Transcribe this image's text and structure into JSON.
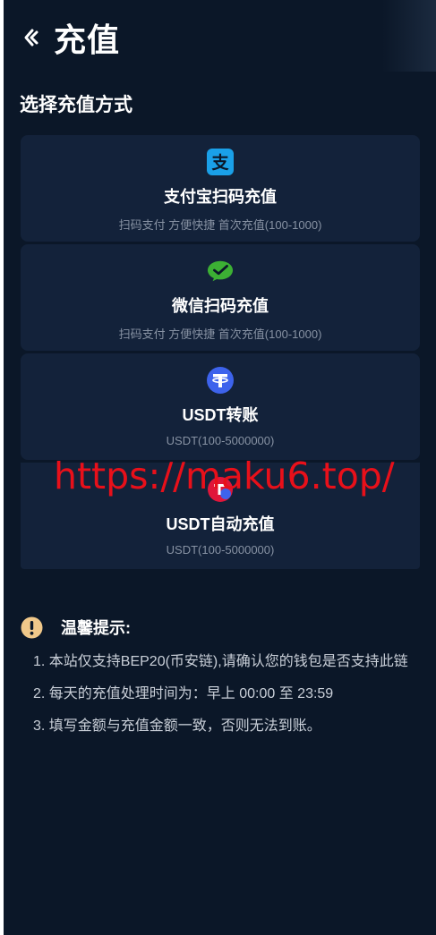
{
  "header": {
    "title": "充值"
  },
  "section_title": "选择充值方式",
  "methods": [
    {
      "name": "支付宝扫码充值",
      "desc": "扫码支付 方便快捷 首次充值(100-1000)",
      "icon": "alipay-icon",
      "color": "#1aa0e8"
    },
    {
      "name": "微信扫码充值",
      "desc": "扫码支付 方便快捷 首次充值(100-1000)",
      "icon": "wechat-icon",
      "color": "#3cb034"
    },
    {
      "name": "USDT转账",
      "desc": "USDT(100-5000000)",
      "icon": "tether-icon",
      "color": "#3d63ec"
    },
    {
      "name": "USDT自动充值",
      "desc": "USDT(100-5000000)",
      "icon": "usdt-auto-icon",
      "color": "#e0163a"
    }
  ],
  "watermark": "https://maku6.top/",
  "tips": {
    "title": "温馨提示:",
    "items": [
      "1. 本站仅支持BEP20(币安链),请确认您的钱包是否支持此链",
      "2. 每天的充值处理时间为：早上 00:00 至 23:59",
      "3. 填写金额与充值金额一致，否则无法到账。"
    ]
  }
}
